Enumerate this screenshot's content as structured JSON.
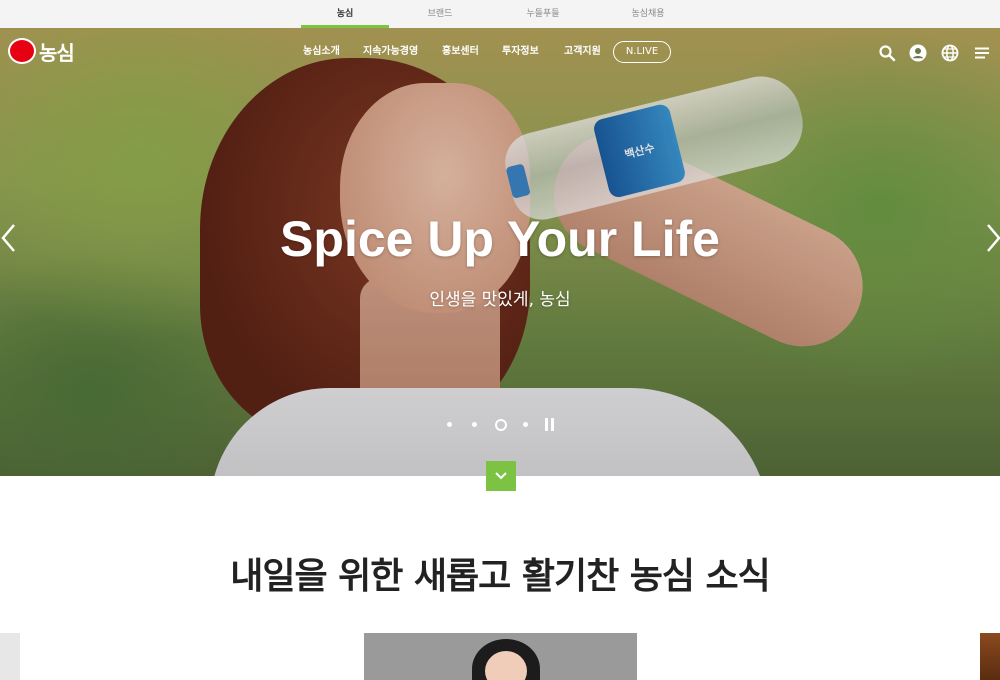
{
  "top_tabs": [
    {
      "label": "농심",
      "active": true
    },
    {
      "label": "브랜드",
      "active": false
    },
    {
      "label": "누들푸들",
      "active": false
    },
    {
      "label": "농심채용",
      "active": false
    }
  ],
  "logo": {
    "text": "농심"
  },
  "nav": {
    "items": [
      "농심소개",
      "지속가능경영",
      "홍보센터",
      "투자정보",
      "고객지원"
    ],
    "nlive": "N.LIVE"
  },
  "hero": {
    "headline": "Spice Up Your Life",
    "subline": "인생을 맛있게, 농심",
    "bottle_label": "백산수",
    "slide_count": 4,
    "active_slide": 3
  },
  "section": {
    "title": "내일을 위한 새롭고 활기찬 농심 소식"
  },
  "colors": {
    "accent_green": "#7cc243",
    "brand_red": "#e60012"
  },
  "icons": [
    "search-icon",
    "user-icon",
    "globe-icon",
    "menu-icon",
    "chevron-left-icon",
    "chevron-right-icon",
    "chevron-down-icon",
    "pause-icon"
  ]
}
